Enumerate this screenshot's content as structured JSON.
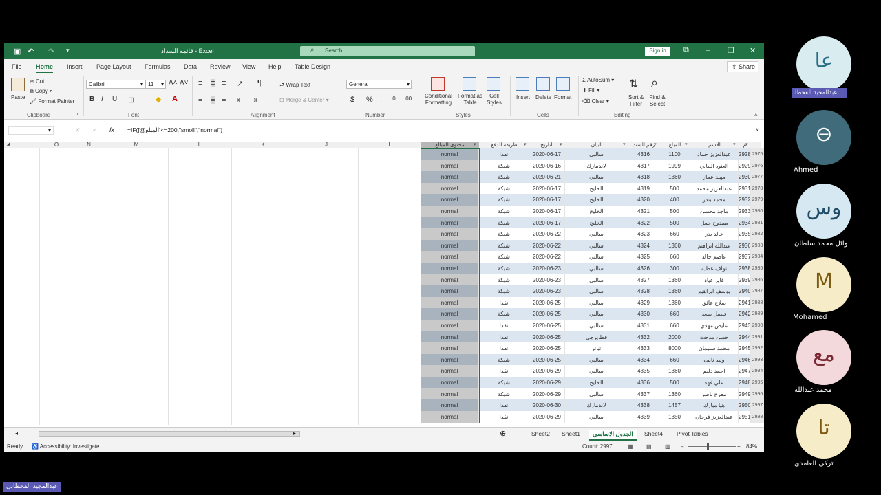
{
  "window": {
    "title": "قائمة السداد - Excel",
    "search_placeholder": "Search",
    "sign_in": "Sign in"
  },
  "menu_tabs": [
    "File",
    "Home",
    "Insert",
    "Page Layout",
    "Formulas",
    "Data",
    "Review",
    "View",
    "Help",
    "Table Design"
  ],
  "active_tab": "Home",
  "share": "Share",
  "ribbon": {
    "paste": "Paste",
    "cut": "Cut",
    "copy": "Copy",
    "format_painter": "Format Painter",
    "clipboard": "Clipboard",
    "font_name": "Calibri",
    "font_size": "11",
    "font": "Font",
    "wrap_text": "Wrap Text",
    "merge_center": "Merge & Center",
    "alignment": "Alignment",
    "number_format": "General",
    "number": "Number",
    "conditional_formatting": "Conditional Formatting",
    "format_as_table": "Format as Table",
    "cell_styles": "Cell Styles",
    "styles": "Styles",
    "insert": "Insert",
    "delete": "Delete",
    "format": "Format",
    "cells": "Cells",
    "autosum": "AutoSum",
    "fill": "Fill",
    "clear": "Clear",
    "sort_filter": "Sort & Filter",
    "find_select": "Find & Select",
    "editing": "Editing"
  },
  "formula": "=IF([@المبلغ]<=200,\"smoll\",\"normal\")",
  "columns_left": [
    "O",
    "N",
    "M",
    "L",
    "K",
    "J",
    "I"
  ],
  "table_headers": [
    "محتوى المبالغ",
    "طريقة الدفع",
    "التاريخ",
    "البيان",
    "رقم السند",
    "المبلغ",
    "الاسم",
    "م"
  ],
  "row_numbers": [
    "2975",
    "2976",
    "2977",
    "2978",
    "2979",
    "2980",
    "2981",
    "2982",
    "2983",
    "2984",
    "2985",
    "2986",
    "2987",
    "2988",
    "2989",
    "2990",
    "2991",
    "2992",
    "2993",
    "2994",
    "2995",
    "2996",
    "2997",
    "2998"
  ],
  "rows": [
    [
      "normal",
      "نقدا",
      "2020-06-17",
      "سالبي",
      "4316",
      "1100",
      "عبدالعزيز حماد",
      "2928"
    ],
    [
      "normal",
      "شبكة",
      "2020-06-16",
      "لاندمارك",
      "4317",
      "1999",
      "العنود البيابي",
      "2929"
    ],
    [
      "normal",
      "شبكة",
      "2020-06-21",
      "سالبي",
      "4318",
      "1360",
      "مهند عمار",
      "2930"
    ],
    [
      "normal",
      "شبكة",
      "2020-06-17",
      "الخليج",
      "4319",
      "500",
      "عبدالعزيز محمد",
      "2931"
    ],
    [
      "normal",
      "شبكة",
      "2020-06-17",
      "الخليج",
      "4320",
      "400",
      "محمد بندر",
      "2932"
    ],
    [
      "normal",
      "شبكة",
      "2020-06-17",
      "الخليج",
      "4321",
      "500",
      "ماجد محسن",
      "2933"
    ],
    [
      "normal",
      "شبكة",
      "2020-06-17",
      "الخليج",
      "4322",
      "500",
      "ممدوح جمل",
      "2934"
    ],
    [
      "normal",
      "شبكة",
      "2020-06-22",
      "سالبي",
      "4323",
      "660",
      "خالد بدر",
      "2935"
    ],
    [
      "normal",
      "شبكة",
      "2020-06-22",
      "سالبي",
      "4324",
      "1360",
      "عبدالله ابراهيم",
      "2936"
    ],
    [
      "normal",
      "شبكة",
      "2020-06-22",
      "سالبي",
      "4325",
      "660",
      "عاصم خالد",
      "2937"
    ],
    [
      "normal",
      "شبكة",
      "2020-06-23",
      "سالبي",
      "4326",
      "300",
      "نواف عطيه",
      "2938"
    ],
    [
      "normal",
      "شبكة",
      "2020-06-23",
      "سالبي",
      "4327",
      "1360",
      "فايز عياد",
      "2939"
    ],
    [
      "normal",
      "شبكة",
      "2020-06-23",
      "سالبي",
      "4328",
      "1360",
      "يوسف ابراهيم",
      "2940"
    ],
    [
      "normal",
      "نقدا",
      "2020-06-25",
      "سالبي",
      "4329",
      "1360",
      "صلاح عائق",
      "2941"
    ],
    [
      "normal",
      "شبكة",
      "2020-06-25",
      "سالبي",
      "4330",
      "660",
      "فيصل سعد",
      "2942"
    ],
    [
      "normal",
      "نقدا",
      "2020-06-25",
      "سالبي",
      "4331",
      "660",
      "عايض مهدي",
      "2943"
    ],
    [
      "normal",
      "نقدا",
      "2020-06-25",
      "فطايرجي",
      "4332",
      "2000",
      "حسن مدحت",
      "2944"
    ],
    [
      "normal",
      "نقدا",
      "2020-06-25",
      "ثياتر",
      "4333",
      "8000",
      "محمد سليمان",
      "2945"
    ],
    [
      "normal",
      "شبكة",
      "2020-06-25",
      "سالبي",
      "4334",
      "660",
      "وليد نايف",
      "2946"
    ],
    [
      "normal",
      "نقدا",
      "2020-06-29",
      "سالبي",
      "4335",
      "1360",
      "احمد دليم",
      "2947"
    ],
    [
      "normal",
      "شبكة",
      "2020-06-29",
      "الخليج",
      "4336",
      "500",
      "علي فهد",
      "2948"
    ],
    [
      "normal",
      "شبكة",
      "2020-06-29",
      "سالبي",
      "4337",
      "1360",
      "مفرح ناصر",
      "2949"
    ],
    [
      "normal",
      "نقدا",
      "2020-06-30",
      "لاندمارك",
      "4338",
      "1457",
      "هيا مبارك",
      "2950"
    ],
    [
      "normal",
      "نقدا",
      "2020-06-29",
      "سالبي",
      "4339",
      "1350",
      "عبدالعزيز فرحان",
      "2951"
    ]
  ],
  "sheet_tabs": [
    "Sheet2",
    "Sheet1",
    "الجدول الاساسي",
    "Sheet4",
    "Pivot Tables"
  ],
  "active_sheet": "الجدول الاساسي",
  "status": {
    "ready": "Ready",
    "accessibility": "Accessibility: Investigate",
    "count": "Count: 2997",
    "zoom": "84%"
  },
  "participants": [
    {
      "initials": "عا",
      "name": "عبدالمجيد القحطا...",
      "bg": "#d9ecf0",
      "fg": "#2b6f86"
    },
    {
      "initials": "",
      "name": "Ahmed",
      "bg": "#3f6b7b",
      "fg": "#ffffff"
    },
    {
      "initials": "وس",
      "name": "وائل محمد سلطان",
      "bg": "#d6e8f2",
      "fg": "#1f4d66"
    },
    {
      "initials": "M",
      "name": "Mohamed",
      "bg": "#f6ecc8",
      "fg": "#7a5a10"
    },
    {
      "initials": "مع",
      "name": "محمد عبدالله",
      "bg": "#f3d9dc",
      "fg": "#7a2a35"
    },
    {
      "initials": "تا",
      "name": "تركي العامدي",
      "bg": "#f6ecc8",
      "fg": "#7a5a10"
    }
  ],
  "presenter_badge": "عبدالمجيد القحطاني",
  "colors": {
    "excel_green": "#217346",
    "table_blue": "#dce6f1",
    "selection": "#a6a6a6"
  }
}
